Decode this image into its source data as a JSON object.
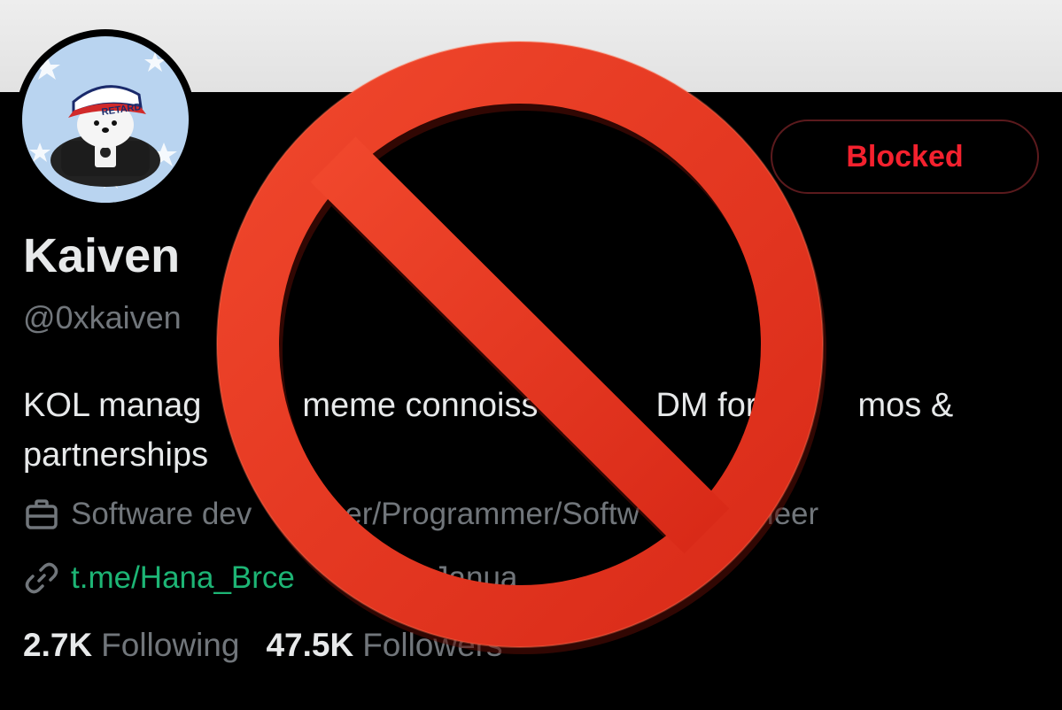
{
  "profile": {
    "name": "Kaiven",
    "handle": "@0xkaiven",
    "action_button": "Blocked",
    "bio": "KOL manag      meme connoiss       DM for      mos &\npartnerships",
    "profession": "Software dev      er/Programmer/Softw      gineer",
    "link": "t.me/Hana_Brce",
    "joined": "    ned Janua",
    "following_count": "2.7K",
    "following_label": "Following",
    "followers_count": "47.5K",
    "followers_label": "Followers"
  },
  "avatar": {
    "cap_text": "RETARD"
  },
  "icons": {
    "profession": "briefcase-icon",
    "link": "link-icon",
    "overlay": "prohibition-sign-icon"
  },
  "colors": {
    "background": "#000000",
    "banner": "#e6e6e6",
    "blocked": "#f4212e",
    "link": "#1db575",
    "muted": "#71767b",
    "prohibition_red": "#e8321f"
  }
}
